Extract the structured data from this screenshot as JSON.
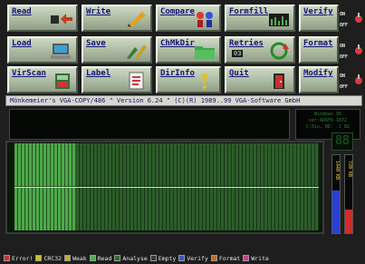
{
  "buttons": {
    "read": "Read",
    "write": "Write",
    "compare": "Compare",
    "formfill": "Formfill",
    "load": "Load",
    "save": "Save",
    "chmkdir": "ChMkDir",
    "retries": "Retries",
    "retries_value": "03",
    "virscan": "VirScan",
    "label": "Label",
    "dirinfo": "DirInfo",
    "quit": "Quit"
  },
  "side": {
    "verify": "Verify",
    "format": "Format",
    "modify": "Modify",
    "on": "ON",
    "off": "OFF"
  },
  "title": "Mönkemeier's VGA-COPY/486  \"  Version 6.24  \" (C)(R) 1989..99 VGA-Software GmbH",
  "disk_info": [
    "Windows 95",
    "ser:AD6FD-1872",
    "C:51o, DE: -1 82"
  ],
  "track_digit": "88",
  "meters": [
    {
      "tag": "1440 KB",
      "level": 0.55,
      "color": "#2b3fd6"
    },
    {
      "tag": "720 KB",
      "level": 0.3,
      "color": "#d42a2a"
    }
  ],
  "legend": [
    {
      "label": "Error!",
      "color": "#c83232"
    },
    {
      "label": "CRC32",
      "color": "#d0c020"
    },
    {
      "label": "Weak",
      "color": "#cfa63a"
    },
    {
      "label": "Read",
      "color": "#4cb04c"
    },
    {
      "label": "Analyse",
      "color": "#2a6f2a"
    },
    {
      "label": "Empty",
      "color": "#3a3a3a"
    },
    {
      "label": "Verify",
      "color": "#3a55d0"
    },
    {
      "label": "Format",
      "color": "#c46a2a"
    },
    {
      "label": "Write",
      "color": "#d03b8a"
    }
  ],
  "map": {
    "tracks_done_fraction": 0.2
  }
}
